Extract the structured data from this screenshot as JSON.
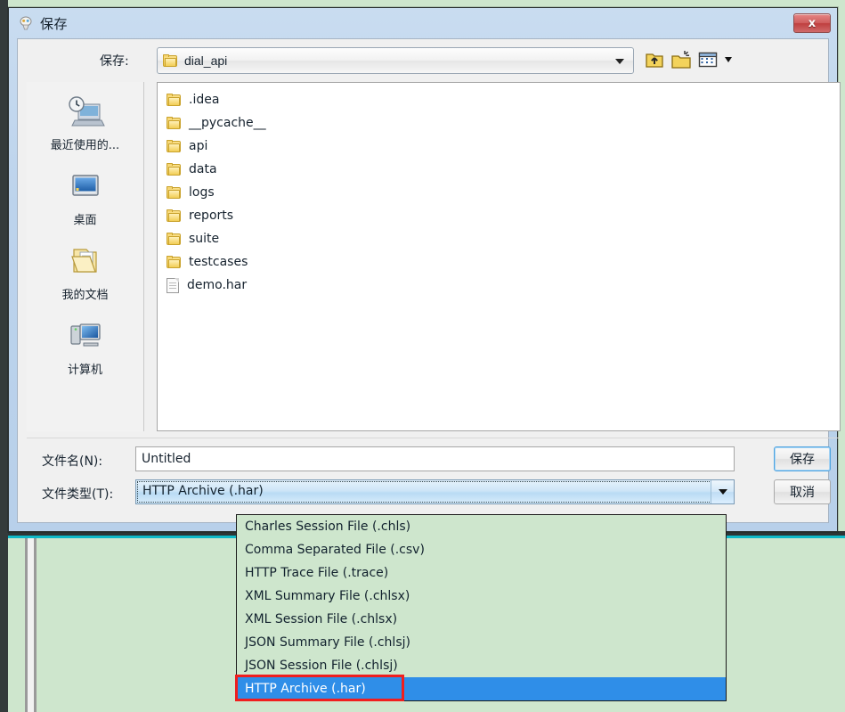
{
  "window": {
    "title": "保存",
    "title_icon": "charles-app-icon",
    "close_label": "x"
  },
  "toolbar": {
    "save_in_label": "保存:",
    "current_directory": "dial_api",
    "directory_icon": "folder-icon",
    "icons": [
      {
        "name": "up-one-level-icon",
        "label": ""
      },
      {
        "name": "new-folder-icon",
        "label": ""
      },
      {
        "name": "view-menu-icon",
        "label": ""
      }
    ]
  },
  "sidebar": {
    "items": [
      {
        "label": "最近使用的...",
        "icon": "recent-items-icon"
      },
      {
        "label": "桌面",
        "icon": "desktop-icon"
      },
      {
        "label": "我的文档",
        "icon": "my-documents-icon"
      },
      {
        "label": "计算机",
        "icon": "computer-icon"
      }
    ]
  },
  "file_list": {
    "items": [
      {
        "name": ".idea",
        "type": "folder"
      },
      {
        "name": "__pycache__",
        "type": "folder"
      },
      {
        "name": "api",
        "type": "folder"
      },
      {
        "name": "data",
        "type": "folder"
      },
      {
        "name": "logs",
        "type": "folder"
      },
      {
        "name": "reports",
        "type": "folder"
      },
      {
        "name": "suite",
        "type": "folder"
      },
      {
        "name": "testcases",
        "type": "folder"
      },
      {
        "name": "demo.har",
        "type": "file"
      }
    ]
  },
  "form": {
    "file_name_label": "文件名(N):",
    "file_name_value": "Untitled",
    "file_type_label": "文件类型(T):",
    "file_type_value": "HTTP Archive (.har)",
    "save_button": "保存",
    "cancel_button": "取消"
  },
  "dropdown": {
    "options": [
      "Charles Session File (.chls)",
      "Comma Separated File (.csv)",
      "HTTP Trace File (.trace)",
      "XML Summary File (.chlsx)",
      "XML Session File (.chlsx)",
      "JSON Summary File (.chlsj)",
      "JSON Session File (.chlsj)",
      "HTTP Archive (.har)"
    ],
    "selected_index": 7,
    "highlight_color": "#2f8ee8",
    "annotation_color": "#f01e1e",
    "background_color": "#cee6cd"
  }
}
